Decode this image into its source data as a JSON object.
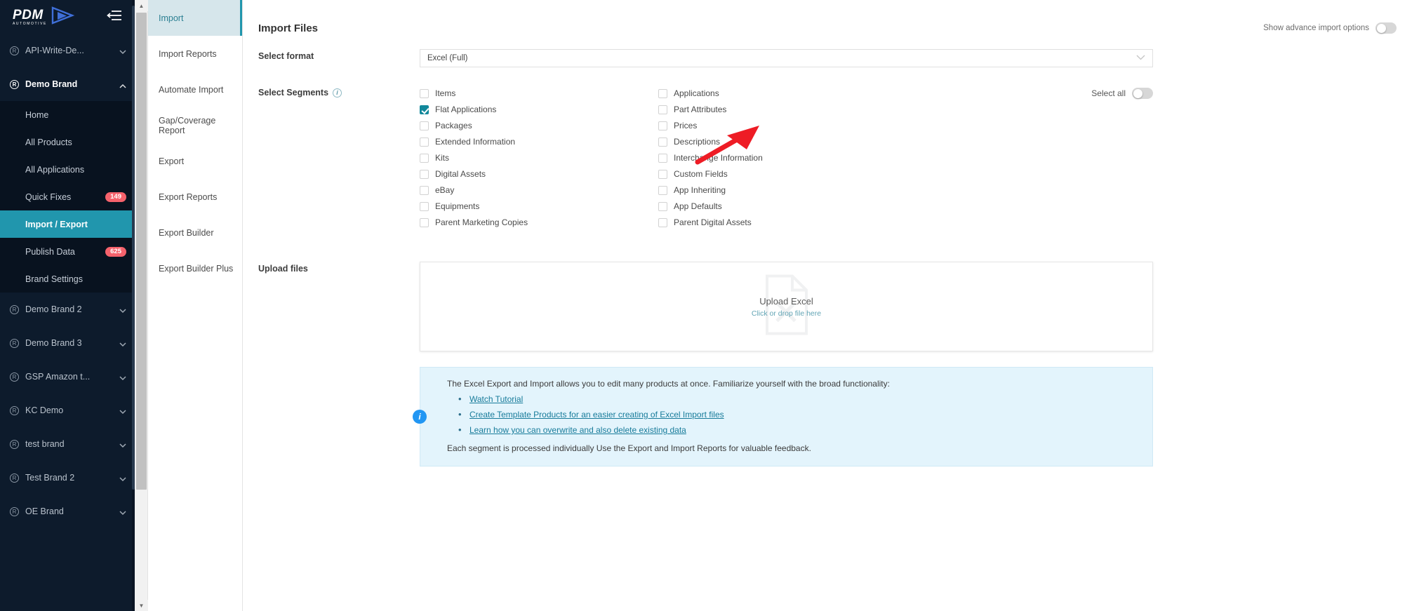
{
  "brand": {
    "logo_name": "PDM",
    "logo_sub": "AUTOMOTIVE",
    "accent": "#2196ad",
    "sidebar_bg": "#0d1b2c",
    "badge_color": "#f5626c",
    "checkbox_checked": "#12889b",
    "link_color": "#177b9a",
    "info_panel_bg": "#e3f4fc"
  },
  "sidebar": {
    "hamburger_icon": "collapse-menu-icon",
    "groups": [
      {
        "label": "API-Write-De...",
        "icon": "registered-icon",
        "chevron": "chevron-down-icon",
        "expanded": false,
        "children": []
      },
      {
        "label": "Demo Brand",
        "icon": "registered-icon",
        "chevron": "chevron-up-icon",
        "expanded": true,
        "children": [
          {
            "label": "Home",
            "badge": "",
            "selected": false
          },
          {
            "label": "All Products",
            "badge": "",
            "selected": false
          },
          {
            "label": "All Applications",
            "badge": "",
            "selected": false
          },
          {
            "label": "Quick Fixes",
            "badge": "149",
            "selected": false
          },
          {
            "label": "Import / Export",
            "badge": "",
            "selected": true
          },
          {
            "label": "Publish Data",
            "badge": "625",
            "selected": false
          },
          {
            "label": "Brand Settings",
            "badge": "",
            "selected": false
          }
        ]
      },
      {
        "label": "Demo Brand 2",
        "icon": "registered-icon",
        "chevron": "chevron-down-icon",
        "expanded": false,
        "children": []
      },
      {
        "label": "Demo Brand 3",
        "icon": "registered-icon",
        "chevron": "chevron-down-icon",
        "expanded": false,
        "children": []
      },
      {
        "label": "GSP Amazon t...",
        "icon": "registered-icon",
        "chevron": "chevron-down-icon",
        "expanded": false,
        "children": []
      },
      {
        "label": "KC Demo",
        "icon": "registered-icon",
        "chevron": "chevron-down-icon",
        "expanded": false,
        "children": []
      },
      {
        "label": "test brand",
        "icon": "registered-icon",
        "chevron": "chevron-down-icon",
        "expanded": false,
        "children": []
      },
      {
        "label": "Test Brand 2",
        "icon": "registered-icon",
        "chevron": "chevron-down-icon",
        "expanded": false,
        "children": []
      },
      {
        "label": "OE Brand",
        "icon": "registered-icon",
        "chevron": "chevron-down-icon",
        "expanded": false,
        "children": []
      }
    ]
  },
  "subnav": {
    "items": [
      {
        "label": "Import",
        "active": true
      },
      {
        "label": "Import Reports",
        "active": false
      },
      {
        "label": "Automate Import",
        "active": false
      },
      {
        "label": "Gap/Coverage Report",
        "active": false
      },
      {
        "label": "Export",
        "active": false
      },
      {
        "label": "Export Reports",
        "active": false
      },
      {
        "label": "Export Builder",
        "active": false
      },
      {
        "label": "Export Builder Plus",
        "active": false
      }
    ]
  },
  "header": {
    "title": "Import Files",
    "advance_options_label": "Show advance import options",
    "advance_options_on": false
  },
  "format": {
    "label": "Select format",
    "value": "Excel (Full)",
    "caret_icon": "chevron-down-icon"
  },
  "segments": {
    "label": "Select Segments",
    "info_icon": "info-circle-icon",
    "select_all_label": "Select all",
    "select_all_on": false,
    "column_left": [
      {
        "label": "Items",
        "checked": false
      },
      {
        "label": "Flat Applications",
        "checked": true
      },
      {
        "label": "Packages",
        "checked": false
      },
      {
        "label": "Extended Information",
        "checked": false
      },
      {
        "label": "Kits",
        "checked": false
      },
      {
        "label": "Digital Assets",
        "checked": false
      },
      {
        "label": "eBay",
        "checked": false
      },
      {
        "label": "Equipments",
        "checked": false
      },
      {
        "label": "Parent Marketing Copies",
        "checked": false
      }
    ],
    "column_right": [
      {
        "label": "Applications",
        "checked": false
      },
      {
        "label": "Part Attributes",
        "checked": false
      },
      {
        "label": "Prices",
        "checked": false
      },
      {
        "label": "Descriptions",
        "checked": false
      },
      {
        "label": "Interchange Information",
        "checked": false
      },
      {
        "label": "Custom Fields",
        "checked": false
      },
      {
        "label": "App Inheriting",
        "checked": false
      },
      {
        "label": "App Defaults",
        "checked": false
      },
      {
        "label": "Parent Digital Assets",
        "checked": false
      }
    ]
  },
  "upload": {
    "label": "Upload files",
    "title": "Upload Excel",
    "subtitle": "Click or drop file here",
    "ghost_icon": "excel-file-icon"
  },
  "info_panel": {
    "dot_icon": "info-icon",
    "lead": "The Excel Export and Import allows you to edit many products at once. Familiarize yourself with the broad functionality:",
    "links": [
      "Watch Tutorial",
      "Create Template Products for an easier creating of Excel Import files",
      "Learn how you can overwrite and also delete existing data"
    ],
    "footer": "Each segment is processed individually Use the Export and Import Reports for valuable feedback."
  },
  "annotation": {
    "arrow_color": "#ee1c25",
    "arrow_points_at": "Flat Applications checkbox"
  }
}
